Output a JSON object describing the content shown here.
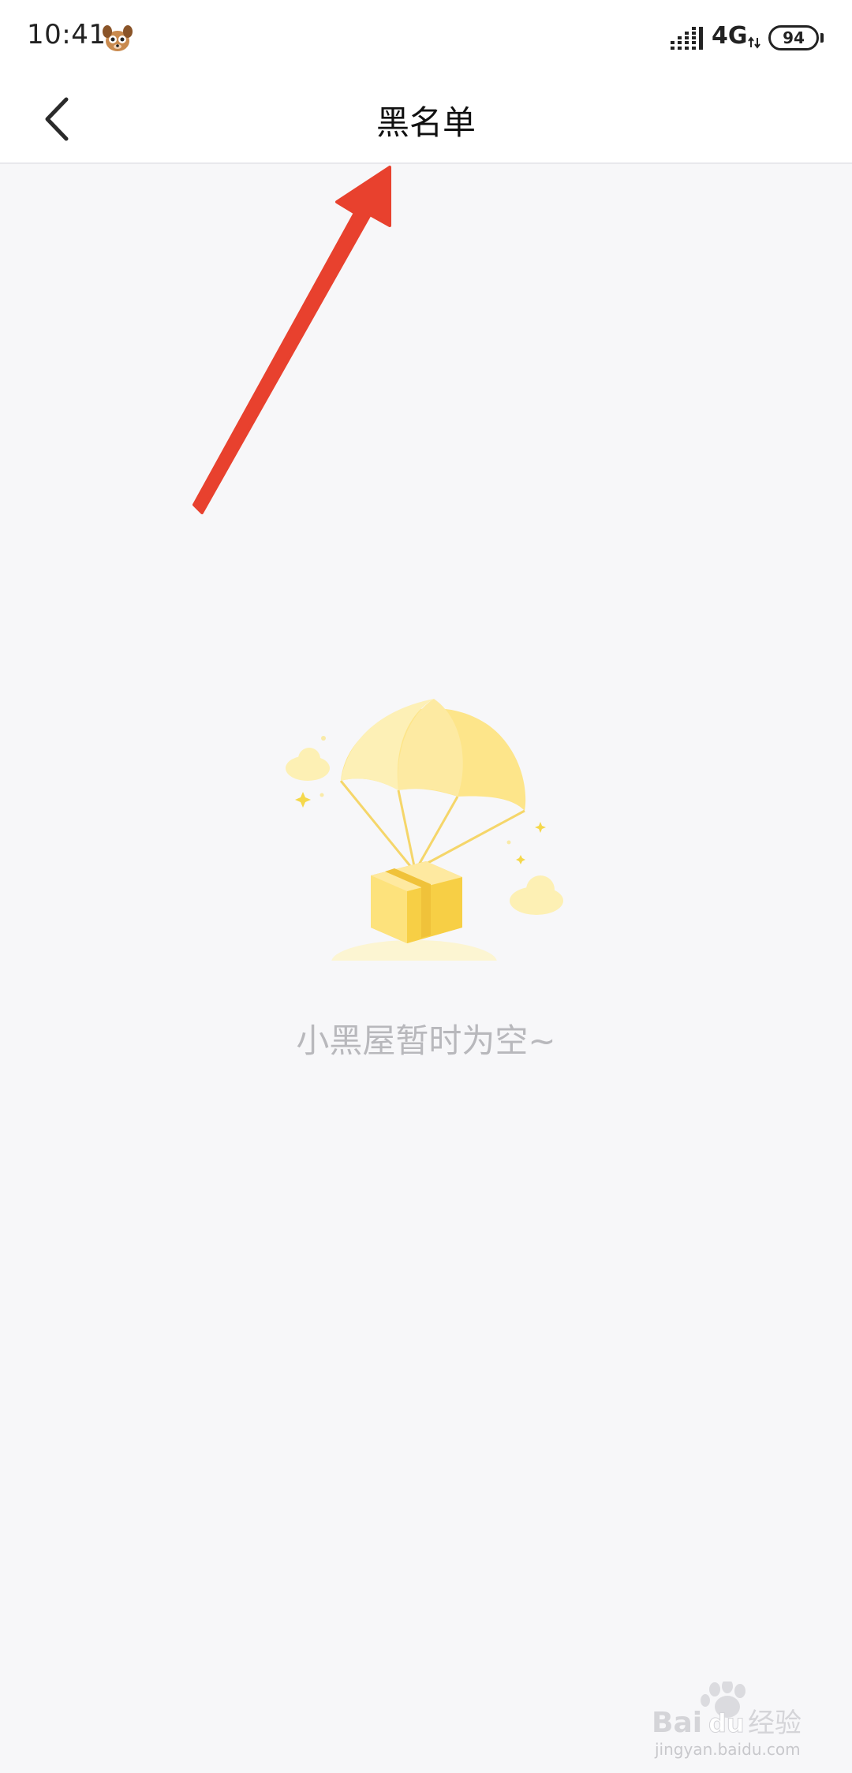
{
  "status_bar": {
    "time": "10:41",
    "network": "4G",
    "battery": "94",
    "icons": [
      "dog-avatar-icon",
      "signal-icon",
      "data-arrows-icon",
      "battery-icon"
    ]
  },
  "header": {
    "title": "黑名单",
    "back_icon": "chevron-left-icon"
  },
  "empty_state": {
    "illustration": "parachute-gift-icon",
    "message": "小黑屋暂时为空~"
  },
  "annotation": {
    "arrow_color": "#e8412e"
  },
  "watermark": {
    "logo_text": "Baidu经验",
    "url": "jingyan.baidu.com"
  },
  "colors": {
    "background": "#f7f7f9",
    "header_bg": "#ffffff",
    "empty_text": "#b8b8bc",
    "illustration_yellow": "#fde58a"
  }
}
